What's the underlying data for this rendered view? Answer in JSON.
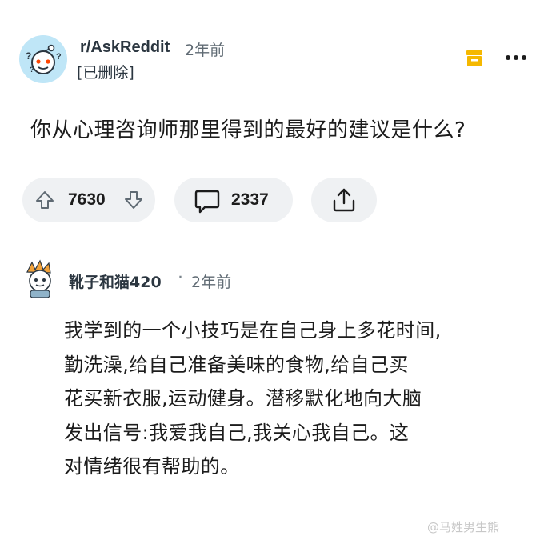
{
  "post": {
    "subreddit": "r/AskReddit",
    "time": "2年前",
    "author": "[已删除]",
    "title": "你从心理咨询师那里得到的最好的建议是什么?",
    "votes": "7630",
    "comments": "2337"
  },
  "comment": {
    "author": "靴子和猫420",
    "separator": "·",
    "time": "2年前",
    "lines": [
      "我学到的一个小技巧是在自己身上多花时间,",
      "勤洗澡,给自己准备美味的食物,给自己买",
      "花买新衣服,运动健身。潜移默化地向大脑",
      "发出信号:我爱我自己,我关心我自己。这",
      "对情绪很有帮助的。"
    ]
  },
  "watermark": "@马姓男生熊",
  "colors": {
    "accent_save": "#f5b800",
    "pill_bg": "#eff1f3",
    "avatar_bg": "#bfe6f7",
    "muted_text": "#5f6a73"
  },
  "icons": {
    "subreddit_avatar": "reddit-snoo-question-icon",
    "save": "save-bookmark-icon",
    "more": "more-horizontal-icon",
    "upvote": "upvote-arrow-icon",
    "downvote": "downvote-arrow-icon",
    "comment": "comment-bubble-icon",
    "share": "share-icon",
    "comment_avatar": "snoo-avatar-icon"
  }
}
